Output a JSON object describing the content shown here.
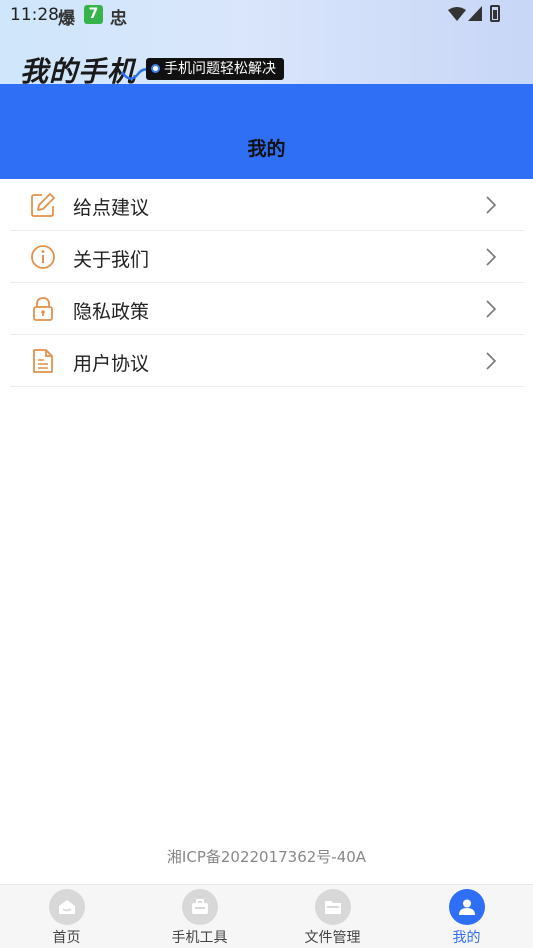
{
  "status_bar": {
    "time": "11:28",
    "glyphs": [
      "爆",
      "7",
      "忠"
    ]
  },
  "banner": {
    "title": "我的手机",
    "tagline": "手机问题轻松解决"
  },
  "header": {
    "title": "我的"
  },
  "menu": {
    "items": [
      {
        "label": "给点建议",
        "icon": "edit-icon"
      },
      {
        "label": "关于我们",
        "icon": "info-icon"
      },
      {
        "label": "隐私政策",
        "icon": "lock-icon"
      },
      {
        "label": "用户协议",
        "icon": "document-icon"
      }
    ]
  },
  "footer": {
    "icp": "湘ICP备2022017362号-40A"
  },
  "tabbar": {
    "tabs": [
      {
        "label": "首页",
        "icon": "home-icon",
        "active": false
      },
      {
        "label": "手机工具",
        "icon": "toolbox-icon",
        "active": false
      },
      {
        "label": "文件管理",
        "icon": "folder-icon",
        "active": false
      },
      {
        "label": "我的",
        "icon": "user-icon",
        "active": true
      }
    ]
  },
  "colors": {
    "accent": "#2f6ff6",
    "menu_icon": "#e3914a",
    "tab_inactive": "#d8d8d8"
  }
}
